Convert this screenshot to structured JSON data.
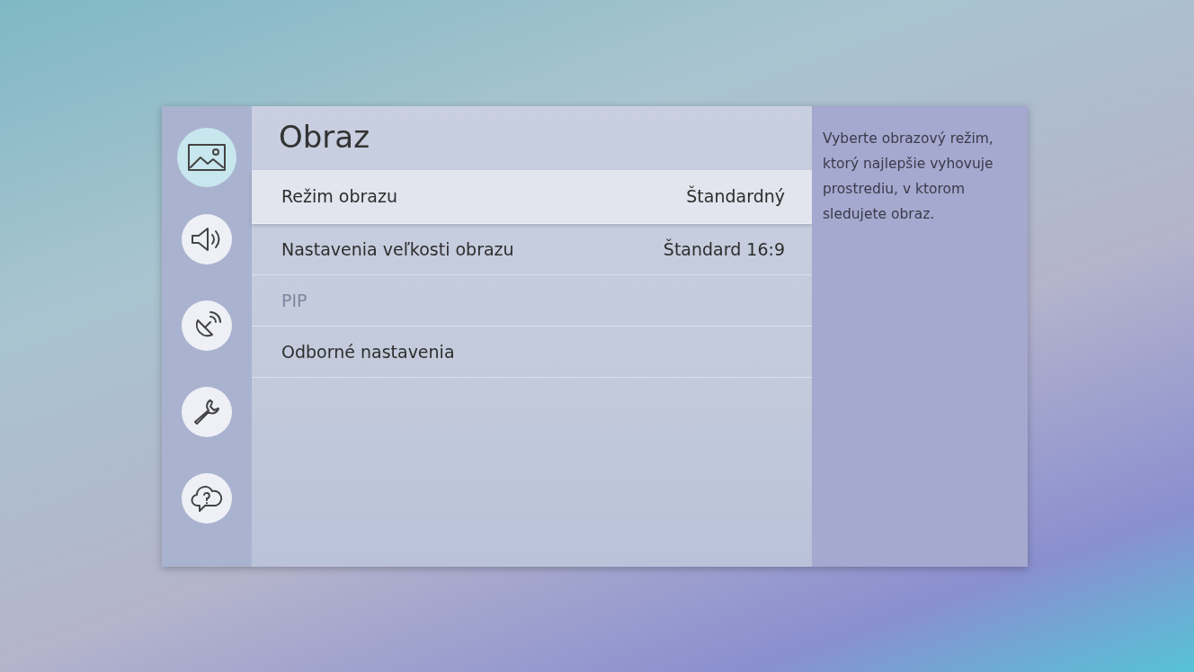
{
  "sidebar": {
    "items": [
      {
        "kind": "picture",
        "selected": true
      },
      {
        "kind": "sound",
        "selected": false
      },
      {
        "kind": "broadcast",
        "selected": false
      },
      {
        "kind": "tools",
        "selected": false
      },
      {
        "kind": "support",
        "selected": false
      }
    ]
  },
  "panel": {
    "title": "Obraz",
    "items": [
      {
        "label": "Režim obrazu",
        "value": "Štandardný",
        "selected": true,
        "disabled": false
      },
      {
        "label": "Nastavenia veľkosti obrazu",
        "value": "Štandard 16:9",
        "selected": false,
        "disabled": false
      },
      {
        "label": "PIP",
        "selected": false,
        "disabled": true
      },
      {
        "label": "Odborné nastavenia",
        "selected": false,
        "disabled": false
      }
    ]
  },
  "help": {
    "text": "Vyberte obrazový režim, ktorý najlepšie vyhovuje prostrediu, v ktorom sledujete obraz."
  }
}
